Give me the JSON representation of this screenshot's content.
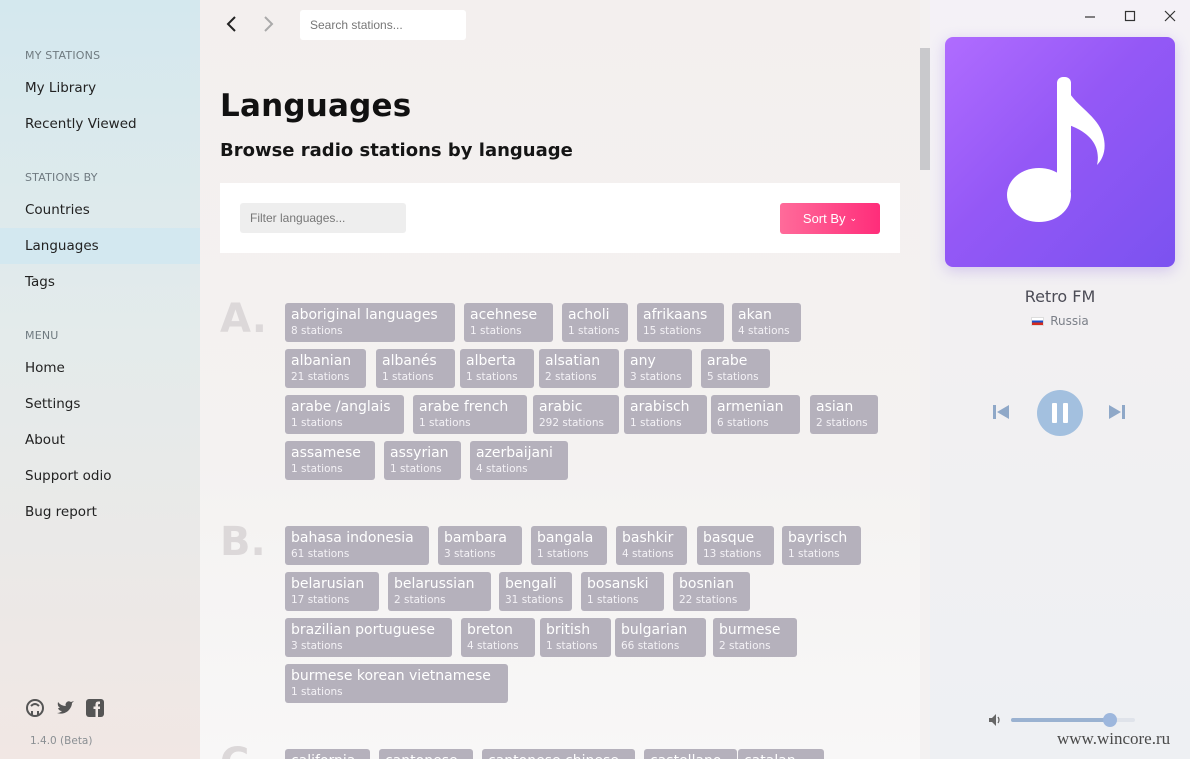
{
  "sidebar": {
    "sections": [
      {
        "heading": "MY STATIONS",
        "items": [
          "My Library",
          "Recently Viewed"
        ]
      },
      {
        "heading": "STATIONS BY",
        "items": [
          "Countries",
          "Languages",
          "Tags"
        ]
      },
      {
        "heading": "MENU",
        "items": [
          "Home",
          "Settings",
          "About",
          "Support odio",
          "Bug report"
        ]
      }
    ],
    "active_item": "Languages",
    "social_icons": [
      "github-icon",
      "twitter-icon",
      "facebook-icon"
    ],
    "version": "1.4.0 (Beta)"
  },
  "topbar": {
    "back_icon": "chevron-left-icon",
    "forward_icon": "chevron-right-icon",
    "search_placeholder": "Search stations..."
  },
  "main": {
    "title": "Languages",
    "subtitle": "Browse radio stations by language",
    "filter_placeholder": "Filter languages...",
    "sort_label": "Sort By",
    "sort_icon": "chevron-down-icon",
    "groups": [
      {
        "letter": "A.",
        "rows": [
          [
            {
              "name": "aboriginal languages",
              "count": "8 stations"
            },
            {
              "name": "acehnese",
              "count": "1 stations"
            },
            {
              "name": "acholi",
              "count": "1 stations"
            },
            {
              "name": "afrikaans",
              "count": "15 stations"
            },
            {
              "name": "akan",
              "count": "4 stations"
            }
          ],
          [
            {
              "name": "albanian",
              "count": "21 stations"
            },
            {
              "name": "albanés",
              "count": "1 stations"
            },
            {
              "name": "alberta",
              "count": "1 stations"
            },
            {
              "name": "alsatian",
              "count": "2 stations"
            },
            {
              "name": "any",
              "count": "3 stations"
            },
            {
              "name": "arabe",
              "count": "5 stations"
            }
          ],
          [
            {
              "name": "arabe /anglais",
              "count": "1 stations"
            },
            {
              "name": "arabe french",
              "count": "1 stations"
            },
            {
              "name": "arabic",
              "count": "292 stations"
            },
            {
              "name": "arabisch",
              "count": "1 stations"
            },
            {
              "name": "armenian",
              "count": "6 stations"
            },
            {
              "name": "asian",
              "count": "2 stations"
            }
          ],
          [
            {
              "name": "assamese",
              "count": "1 stations"
            },
            {
              "name": "assyrian",
              "count": "1 stations"
            },
            {
              "name": "azerbaijani",
              "count": "4 stations"
            }
          ]
        ]
      },
      {
        "letter": "B.",
        "rows": [
          [
            {
              "name": "bahasa indonesia",
              "count": "61 stations"
            },
            {
              "name": "bambara",
              "count": "3 stations"
            },
            {
              "name": "bangala",
              "count": "1 stations"
            },
            {
              "name": "bashkir",
              "count": "4 stations"
            },
            {
              "name": "basque",
              "count": "13 stations"
            },
            {
              "name": "bayrisch",
              "count": "1 stations"
            }
          ],
          [
            {
              "name": "belarusian",
              "count": "17 stations"
            },
            {
              "name": "belarussian",
              "count": "2 stations"
            },
            {
              "name": "bengali",
              "count": "31 stations"
            },
            {
              "name": "bosanski",
              "count": "1 stations"
            },
            {
              "name": "bosnian",
              "count": "22 stations"
            }
          ],
          [
            {
              "name": "brazilian portuguese",
              "count": "3 stations"
            },
            {
              "name": "breton",
              "count": "4 stations"
            },
            {
              "name": "british",
              "count": "1 stations"
            },
            {
              "name": "bulgarian",
              "count": "66 stations"
            },
            {
              "name": "burmese",
              "count": "2 stations"
            }
          ],
          [
            {
              "name": "burmese korean vietnamese",
              "count": "1 stations"
            }
          ]
        ]
      },
      {
        "letter": "C.",
        "rows": [
          [
            {
              "name": "california",
              "count": ""
            },
            {
              "name": "cantonese",
              "count": ""
            },
            {
              "name": "cantonese chinese",
              "count": ""
            },
            {
              "name": "castellano",
              "count": ""
            },
            {
              "name": "catalan",
              "count": ""
            }
          ]
        ]
      }
    ]
  },
  "player": {
    "window_controls": [
      "minimize-icon",
      "maximize-icon",
      "close-icon"
    ],
    "artwork_icon": "music-note-icon",
    "station_name": "Retro FM",
    "station_country": "Russia",
    "controls": [
      "previous-icon",
      "pause-icon",
      "next-icon"
    ],
    "volume_icon": "volume-icon",
    "volume_level": 0.8,
    "accent_color": "#a3c0df",
    "watermark": "www.wincore.ru"
  },
  "colors": {
    "tag_bg": "#b5b1bc",
    "sort_gradient": [
      "#ff6b9a",
      "#ff2d7a"
    ],
    "art_gradient": [
      "#b06cff",
      "#7b52f0"
    ]
  }
}
